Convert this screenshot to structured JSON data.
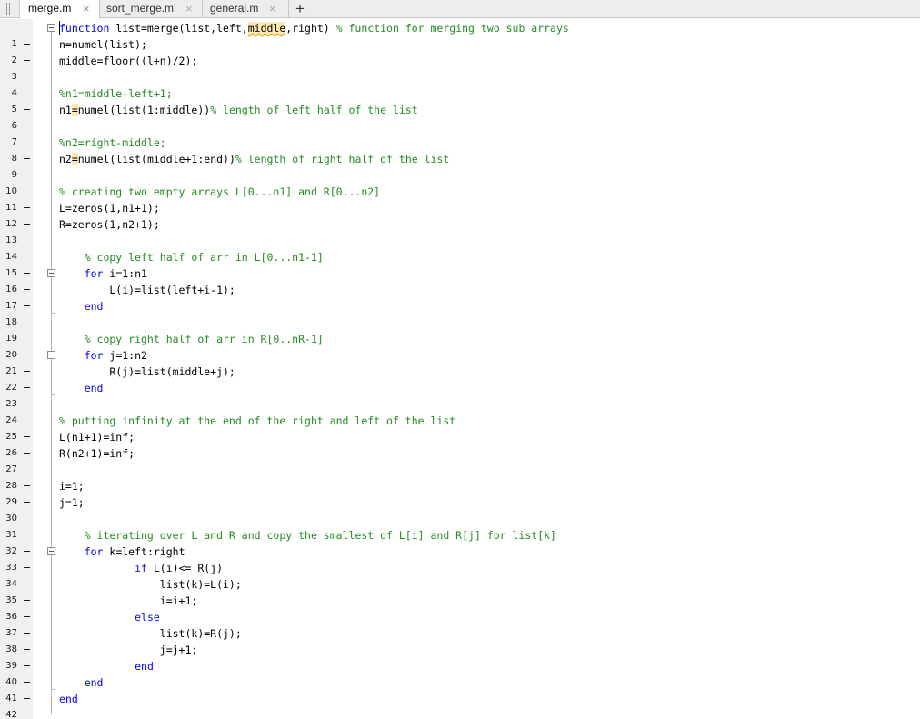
{
  "tabs": [
    {
      "name": "merge.m",
      "close": "×",
      "active": true
    },
    {
      "name": "sort_merge.m",
      "close": "×",
      "active": false
    },
    {
      "name": "general.m",
      "close": "×",
      "active": false
    }
  ],
  "add_tab_label": "+",
  "colors": {
    "keyword": "#0000ff",
    "comment": "#228b22",
    "text": "#000000",
    "highlight": "#fce8b2",
    "gutter": "#f0f0f0"
  },
  "code": {
    "l1": {
      "n": "1",
      "t1": "function",
      "t2": " list=merge(list,left,",
      "t3": "middle",
      "t4": ",right) ",
      "t5": "% function for merging two sub arrays"
    },
    "l2": {
      "n": "2",
      "t1": "n=numel(list);"
    },
    "l3": {
      "n": "3",
      "t1": "middle=floor((l+n)/2);"
    },
    "l4": {
      "n": "4"
    },
    "l5": {
      "n": "5",
      "t1": "%n1=middle-left+1;"
    },
    "l6": {
      "n": "6",
      "t1": "n1",
      "t2": "=",
      "t3": "numel(list(1:middle))",
      "t4": "% length of left half of the list"
    },
    "l7": {
      "n": "7"
    },
    "l8": {
      "n": "8",
      "t1": "%n2=right-middle;"
    },
    "l9": {
      "n": "9",
      "t1": "n2",
      "t2": "=",
      "t3": "numel(list(middle+1:end))",
      "t4": "% length of right half of the list"
    },
    "l10": {
      "n": "10"
    },
    "l11": {
      "n": "11",
      "t1": "% creating two empty arrays L[0...n1] and R[0...n2]"
    },
    "l12": {
      "n": "12",
      "t1": "L=zeros(1,n1+1);"
    },
    "l13": {
      "n": "13",
      "t1": "R=zeros(1,n2+1);"
    },
    "l14": {
      "n": "14"
    },
    "l15": {
      "n": "15",
      "t1": "    % copy left half of arr in L[0...n1-1]"
    },
    "l16": {
      "n": "16",
      "t1": "    ",
      "t2": "for",
      "t3": " i=1:n1"
    },
    "l17": {
      "n": "17",
      "t1": "        L(i)=list(left+i-1);"
    },
    "l18": {
      "n": "18",
      "t1": "    ",
      "t2": "end"
    },
    "l19": {
      "n": "19"
    },
    "l20": {
      "n": "20",
      "t1": "    % copy right half of arr in R[0..nR-1]"
    },
    "l21": {
      "n": "21",
      "t1": "    ",
      "t2": "for",
      "t3": " j=1:n2"
    },
    "l22": {
      "n": "22",
      "t1": "        R(j)=list(middle+j);"
    },
    "l23": {
      "n": "23",
      "t1": "    ",
      "t2": "end"
    },
    "l24": {
      "n": "24"
    },
    "l25": {
      "n": "25",
      "t1": "% putting infinity at the end of the right and left of the list"
    },
    "l26": {
      "n": "26",
      "t1": "L(n1+1)=inf;"
    },
    "l27": {
      "n": "27",
      "t1": "R(n2+1)=inf;"
    },
    "l28": {
      "n": "28"
    },
    "l29": {
      "n": "29",
      "t1": "i=1;"
    },
    "l30": {
      "n": "30",
      "t1": "j=1;"
    },
    "l31": {
      "n": "31"
    },
    "l32": {
      "n": "32",
      "t1": "    % iterating over L and R and copy the smallest of L[i] and R[j] for list[k]"
    },
    "l33": {
      "n": "33",
      "t1": "    ",
      "t2": "for",
      "t3": " k=left:right"
    },
    "l34": {
      "n": "34",
      "t1": "            ",
      "t2": "if",
      "t3": " L(i)<= R(j)"
    },
    "l35": {
      "n": "35",
      "t1": "                list(k)=L(i);"
    },
    "l36": {
      "n": "36",
      "t1": "                i=i+1;"
    },
    "l37": {
      "n": "37",
      "t1": "            ",
      "t2": "else"
    },
    "l38": {
      "n": "38",
      "t1": "                list(k)=R(j);"
    },
    "l39": {
      "n": "39",
      "t1": "                j=j+1;"
    },
    "l40": {
      "n": "40",
      "t1": "            ",
      "t2": "end"
    },
    "l41": {
      "n": "41",
      "t1": "    ",
      "t2": "end"
    },
    "l42": {
      "n": "42",
      "t1": "end"
    }
  }
}
